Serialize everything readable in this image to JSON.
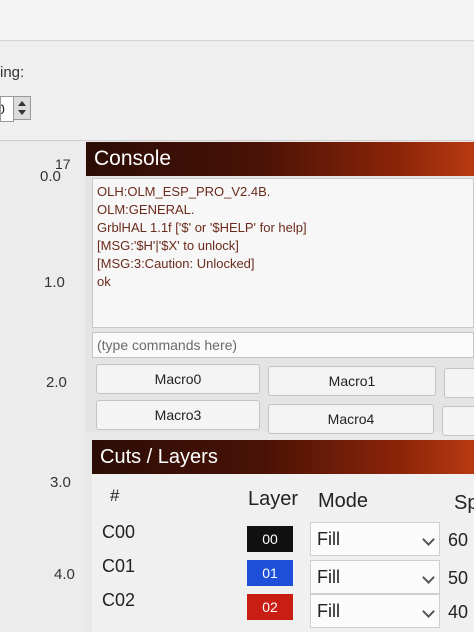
{
  "settings": {
    "label": "ing:",
    "spin_value": "0"
  },
  "ruler": {
    "ticks": [
      "0.0",
      "1.0",
      "2.0",
      "3.0",
      "4.0"
    ],
    "overlay_tick": "17"
  },
  "console": {
    "title": "Console",
    "lines": [
      "OLH:OLM_ESP_PRO_V2.4B.",
      "OLM:GENERAL.",
      "GrblHAL 1.1f ['$' or '$HELP' for help]",
      "[MSG:'$H'|'$X' to unlock]",
      "[MSG:3:Caution: Unlocked]",
      "ok"
    ],
    "input_placeholder": "(type commands here)",
    "macros": [
      "Macro0",
      "Macro1",
      "Macro3",
      "Macro4"
    ]
  },
  "cuts": {
    "title": "Cuts / Layers",
    "headers": {
      "num": "#",
      "layer": "Layer",
      "mode": "Mode",
      "speed": "Sp"
    },
    "rows": [
      {
        "id": "C00",
        "layer": "00",
        "color": "#111111",
        "mode": "Fill",
        "speed": "60"
      },
      {
        "id": "C01",
        "layer": "01",
        "color": "#1e4fd8",
        "mode": "Fill",
        "speed": "50"
      },
      {
        "id": "C02",
        "layer": "02",
        "color": "#c81e14",
        "mode": "Fill",
        "speed": "40"
      }
    ]
  }
}
